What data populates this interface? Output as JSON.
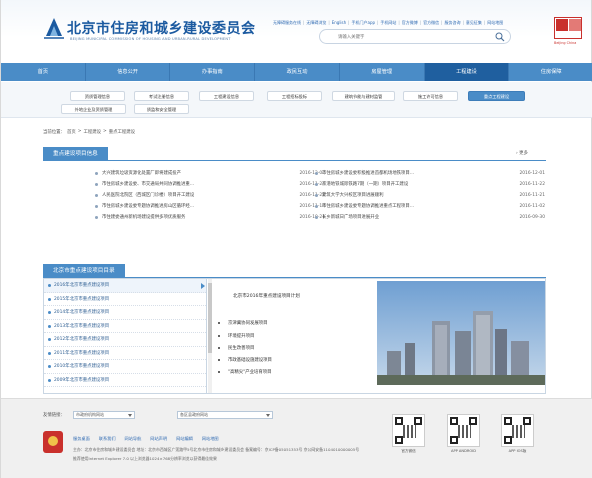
{
  "header": {
    "title": "北京市住房和城乡建设委员会",
    "subtitle": "BEIJING MUNICIPAL COMMISSION OF HOUSING AND URBAN-RURAL DEVELOPMENT",
    "toplinks": [
      "无障碍服务在线",
      "无障碍浏览",
      "English",
      "手机门户app",
      "手机网站",
      "官方微博",
      "官方微信",
      "服务咨询",
      "意见征集",
      "网站地图"
    ],
    "search_placeholder": "请输入关键字",
    "badge_caption": "Beijing China"
  },
  "nav": {
    "items": [
      "首页",
      "信息公开",
      "办事指南",
      "政民互动",
      "房屋管理",
      "工程建设",
      "住房保障"
    ],
    "active_index": 5
  },
  "subnav": {
    "row1": [
      "资质管理信息",
      "考试注册信息",
      "工程建设信息",
      "工程招标投标",
      "建筑节能与建材监管",
      "施工许可信息",
      "重点工程建设"
    ],
    "row2": [
      "外地企业及资质管理",
      "质监和安全管理"
    ],
    "active": "重点工程建设"
  },
  "breadcrumb": [
    "当前位置：",
    "首页",
    ">",
    "工程建设",
    ">",
    "重点工程建设"
  ],
  "key_projects": {
    "title": "重点建设项目信息",
    "more": "更多",
    "left": [
      {
        "title": "大兴建筑垃圾资源化处置厂即将建成投产",
        "date": "2016-12-02"
      },
      {
        "title": "市住房城乡建设委、市交通局共同协调推进重...",
        "date": "2016-11-24"
      },
      {
        "title": "人民医院北院区（西城区门诊楼）项目开工建设",
        "date": "2016-11-21"
      },
      {
        "title": "市住房城乡建设委专题协调推进房山区循环经...",
        "date": "2016-11-18"
      },
      {
        "title": "市住建委通州新机场建设提供多项优质服务",
        "date": "2016-10-21"
      }
    ],
    "right": [
      {
        "title": "市住房城乡建设委积极推进首都机场地铁项目...",
        "date": "2016-12-01"
      },
      {
        "title": "京港地铁城际铁路7期（一期）项目开工建设",
        "date": "2016-11-22"
      },
      {
        "title": "建筑大学大兴校区项目进展顺利",
        "date": "2016-11-21"
      },
      {
        "title": "市住房城乡建设委专题协调推进重点工程项目...",
        "date": "2016-11-02"
      },
      {
        "title": "长乡新城日广场项目进展开业",
        "date": "2016-09-30"
      }
    ]
  },
  "directory": {
    "title": "北京市重点建设项目目录",
    "years": [
      "2016年北京市重点建设项目",
      "2015年北京市重点建设项目",
      "2014年北京市重点建设项目",
      "2013年北京市重点建设项目",
      "2012年北京市重点建设项目",
      "2011年北京市重点建设项目",
      "2010年北京市重点建设项目",
      "2009年北京市重点建设项目"
    ],
    "selected_index": 0,
    "detail_title": "北京市2016年重点建设项目计划",
    "detail_items": [
      "京津冀协同发展项目",
      "环境提升项目",
      "民生改善项目",
      "市政基础设施建设项目",
      "\"高精尖\"产业培育项目"
    ]
  },
  "footer": {
    "links_label": "友情链接：",
    "select1": "市政府机构网站",
    "select2": "各区县政府网站",
    "nav_links": [
      "服务桌面",
      "联系我们",
      "网站导航",
      "网站声明",
      "网站编辑",
      "网站地图"
    ],
    "line1": "主办：北京市住房和城乡建设委员会  地址：北京市西城区广莲路甲5号北京市住房和城乡建设委员会  备案编号：京ICP备05051353号  京公网安备1104010000005号",
    "line2": "推荐使用Internet Explorer 7.0 以上浏览器1024×768分辨率浏览以获得最佳效果",
    "qr": [
      "官方微信",
      "APP ANDROID",
      "APP IOS版"
    ]
  }
}
